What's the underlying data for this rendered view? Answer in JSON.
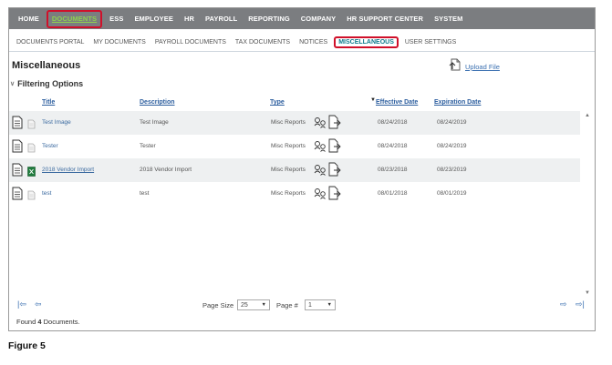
{
  "top_nav": [
    "HOME",
    "DOCUMENTS",
    "ESS",
    "EMPLOYEE",
    "HR",
    "PAYROLL",
    "REPORTING",
    "COMPANY",
    "HR SUPPORT CENTER",
    "SYSTEM"
  ],
  "top_nav_active": "DOCUMENTS",
  "sub_nav": [
    "DOCUMENTS PORTAL",
    "MY DOCUMENTS",
    "PAYROLL DOCUMENTS",
    "TAX DOCUMENTS",
    "NOTICES",
    "MISCELLANEOUS",
    "USER SETTINGS"
  ],
  "sub_nav_active": "MISCELLANEOUS",
  "page_title": "Miscellaneous",
  "upload_label": "Upload File",
  "filter_label": "Filtering Options",
  "columns": {
    "title": "Title",
    "description": "Description",
    "type": "Type",
    "effective_date": "Effective Date",
    "expiration_date": "Expiration Date"
  },
  "rows": [
    {
      "title": "Test Image",
      "description": "Test Image",
      "type": "Misc Reports",
      "effective": "08/24/2018",
      "expiration": "08/24/2019",
      "file_icon": "file-icon"
    },
    {
      "title": "Tester",
      "description": "Tester",
      "type": "Misc Reports",
      "effective": "08/24/2018",
      "expiration": "08/24/2019",
      "file_icon": "file-icon"
    },
    {
      "title": "2018 Vendor Import",
      "description": "2018 Vendor Import",
      "type": "Misc Reports",
      "effective": "08/23/2018",
      "expiration": "08/23/2019",
      "file_icon": "excel-icon"
    },
    {
      "title": "test",
      "description": "test",
      "type": "Misc Reports",
      "effective": "08/01/2018",
      "expiration": "08/01/2019",
      "file_icon": "file-icon"
    }
  ],
  "pager": {
    "page_size_label": "Page Size",
    "page_size": "25",
    "page_label": "Page #",
    "page": "1"
  },
  "found": {
    "prefix": "Found ",
    "count": "4",
    "suffix": " Documents."
  },
  "caption": "Figure 5",
  "colors": {
    "accent_active": "#8fd14f",
    "highlight_box": "#d0102a",
    "link": "#3a6fb0",
    "nav_bg": "#7b7d80"
  }
}
